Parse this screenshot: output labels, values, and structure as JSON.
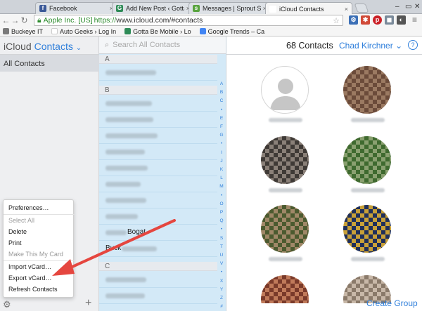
{
  "browser": {
    "tabs": [
      {
        "title": "Facebook",
        "icon": "facebook-icon",
        "color": "#3b5998",
        "glyph": "f"
      },
      {
        "title": "Add New Post ‹ Gotta Be M",
        "icon": "gbm-icon",
        "color": "#2e8b57",
        "glyph": "G"
      },
      {
        "title": "Messages | Sprout Social",
        "icon": "sprout-icon",
        "color": "#59a43f",
        "glyph": "s"
      },
      {
        "title": "iCloud Contacts",
        "icon": "apple-icon",
        "color": "#888888",
        "glyph": ""
      }
    ],
    "url_ev": "Apple Inc. [US]",
    "url_scheme": "https://",
    "url_rest": "www.icloud.com/#contacts",
    "bookmarks": [
      {
        "label": "Buckeye IT",
        "color": "#7a7a7a"
      },
      {
        "label": "Auto Geeks › Log In",
        "color": "#c9c9c9"
      },
      {
        "label": "Gotta Be Mobile › Lo",
        "color": "#2e8b57"
      },
      {
        "label": "Google Trends – Ca",
        "color": "#4285f4"
      }
    ]
  },
  "sidebar": {
    "brand": "iCloud",
    "app": "Contacts",
    "all_contacts": "All Contacts"
  },
  "search": {
    "placeholder": "Search All Contacts"
  },
  "list": {
    "sections": [
      "A",
      "B",
      "C"
    ],
    "visible_name": "Buck",
    "visible_name_2": "Bogat",
    "index_letters": [
      "A",
      "B",
      "C",
      "•",
      "E",
      "F",
      "G",
      "•",
      "I",
      "J",
      "K",
      "L",
      "M",
      "•",
      "O",
      "P",
      "Q",
      "•",
      "S",
      "T",
      "U",
      "V",
      "•",
      "X",
      "Y",
      "Z",
      "#"
    ]
  },
  "header": {
    "count": "68 Contacts",
    "user": "Chad Kirchner",
    "help": "?"
  },
  "menu": {
    "items": [
      {
        "label": "Preferences…",
        "enabled": true
      },
      {
        "label": "Select All",
        "enabled": false
      },
      {
        "label": "Delete",
        "enabled": true
      },
      {
        "label": "Print",
        "enabled": true
      },
      {
        "label": "Make This My Card",
        "enabled": false
      },
      {
        "label": "Import vCard…",
        "enabled": true
      },
      {
        "label": "Export vCard…",
        "enabled": true
      },
      {
        "label": "Refresh Contacts",
        "enabled": true
      }
    ]
  },
  "footer": {
    "create_group": "Create Group"
  },
  "colors": {
    "accent": "#2f7fdb",
    "list_bg": "#d3e9f7",
    "arrow": "#e5463f"
  }
}
